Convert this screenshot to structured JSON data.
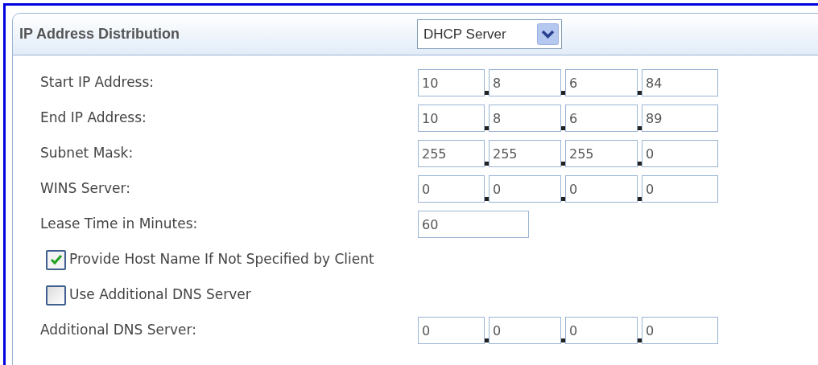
{
  "section": {
    "title": "IP Address Distribution",
    "select": {
      "value": "DHCP Server"
    }
  },
  "rows": [
    {
      "kind": "ip",
      "label": "Start IP Address:",
      "octets": [
        "10",
        "8",
        "6",
        "84"
      ]
    },
    {
      "kind": "ip",
      "label": "End IP Address:",
      "octets": [
        "10",
        "8",
        "6",
        "89"
      ]
    },
    {
      "kind": "ip",
      "label": "Subnet Mask:",
      "octets": [
        "255",
        "255",
        "255",
        "0"
      ]
    },
    {
      "kind": "ip",
      "label": "WINS Server:",
      "octets": [
        "0",
        "0",
        "0",
        "0"
      ]
    },
    {
      "kind": "text",
      "label": "Lease Time in Minutes:",
      "value": "60"
    },
    {
      "kind": "checkbox",
      "label": "Provide Host Name If Not Specified by Client",
      "checked": true
    },
    {
      "kind": "checkbox",
      "label": "Use Additional DNS Server",
      "checked": false
    },
    {
      "kind": "ip",
      "label": "Additional DNS Server:",
      "octets": [
        "0",
        "0",
        "0",
        "0"
      ]
    }
  ]
}
